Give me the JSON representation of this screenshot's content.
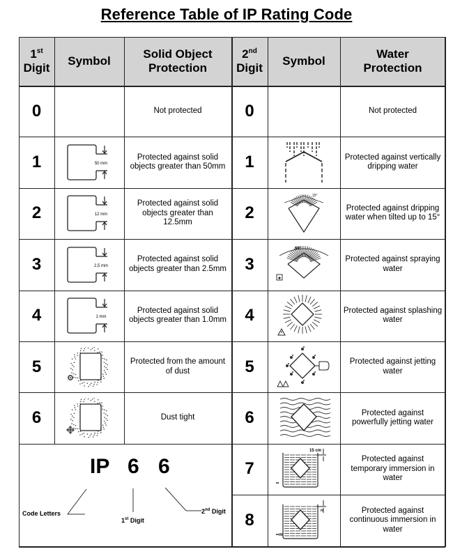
{
  "title": "Reference Table of IP Rating Code",
  "headers": {
    "first_digit": {
      "num": "1",
      "sup": "st",
      "label": "Digit"
    },
    "symbol_left": "Symbol",
    "solid": {
      "line1": "Solid Object",
      "line2": "Protection"
    },
    "second_digit": {
      "num": "2",
      "sup": "nd",
      "label": "Digit"
    },
    "symbol_right": "Symbol",
    "water": {
      "line1": "Water",
      "line2": "Protection"
    }
  },
  "solid_rows": [
    {
      "digit": "0",
      "symbol": "none",
      "description": "Not protected"
    },
    {
      "digit": "1",
      "symbol": "box-gap-icon",
      "gap_label": "50 mm",
      "description": "Protected against solid objects greater than 50mm"
    },
    {
      "digit": "2",
      "symbol": "box-gap-icon",
      "gap_label": "12 mm",
      "description": "Protected against solid objects greater than 12.5mm"
    },
    {
      "digit": "3",
      "symbol": "box-gap-icon",
      "gap_label": "2,5 mm",
      "description": "Protected against solid objects greater than 2.5mm"
    },
    {
      "digit": "4",
      "symbol": "box-gap-icon",
      "gap_label": "1 mm",
      "description": "Protected against solid objects greater than 1.0mm"
    },
    {
      "digit": "5",
      "symbol": "dust-protected-icon",
      "description": "Protected from the amount of dust"
    },
    {
      "digit": "6",
      "symbol": "dust-tight-icon",
      "description": "Dust tight"
    }
  ],
  "water_rows": [
    {
      "digit": "0",
      "symbol": "none",
      "description": "Not protected"
    },
    {
      "digit": "1",
      "symbol": "vertical-drip-icon",
      "description": "Protected against vertically dripping water"
    },
    {
      "digit": "2",
      "symbol": "tilted-drip-icon",
      "angle_label": "15°",
      "description": "Protected against dripping water when tilted up to 15°"
    },
    {
      "digit": "3",
      "symbol": "spray-icon",
      "angle_label": "60°",
      "description": "Protected against spraying water"
    },
    {
      "digit": "4",
      "symbol": "splash-icon",
      "description": "Protected against splashing water"
    },
    {
      "digit": "5",
      "symbol": "jet-icon",
      "description": "Protected against jetting water"
    },
    {
      "digit": "6",
      "symbol": "powerful-jet-icon",
      "description": "Protected against powerfully jetting water"
    },
    {
      "digit": "7",
      "symbol": "temporary-immersion-icon",
      "depth_label": "15 cm",
      "description": "Protected against temporary immersion in water"
    },
    {
      "digit": "8",
      "symbol": "continuous-immersion-icon",
      "depth_label": "m",
      "description": "Protected against continuous immersion in water"
    }
  ],
  "ip_example": {
    "letters": "IP",
    "first": "6",
    "second": "6",
    "code_letters_label": "Code Letters",
    "first_label": {
      "num": "1",
      "sup": "st",
      "text": "Digit"
    },
    "second_label": {
      "num": "2",
      "sup": "nd",
      "text": "Digit"
    }
  }
}
